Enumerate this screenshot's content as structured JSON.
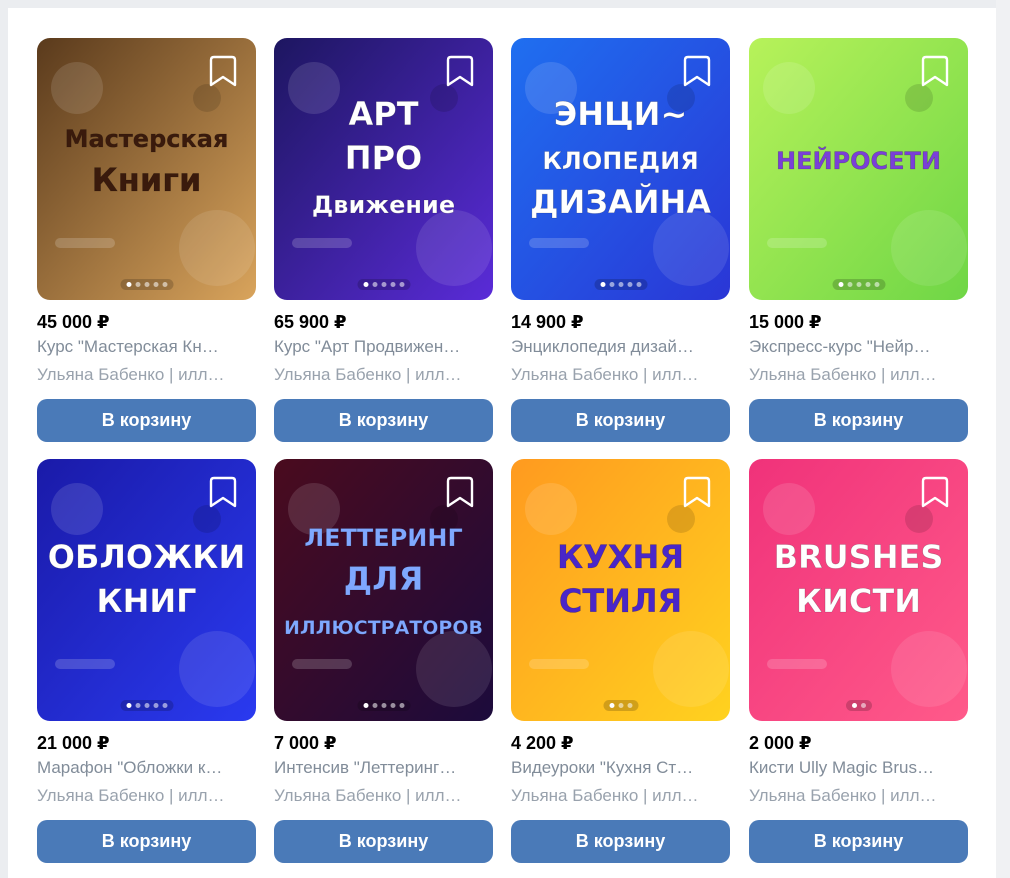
{
  "products": [
    {
      "price": "45 000 ₽",
      "title": "Курс \"Мастерская Кн…",
      "seller": "Ульяна Бабенко | илл…",
      "cart_label": "В корзину",
      "art": {
        "lines": [
          "Мастерская",
          "Книги"
        ],
        "colors": [
          "#5a3a1c",
          "#d9a45c"
        ],
        "text_color": "#3a1a0c"
      },
      "dots": 5,
      "active_dot": 0
    },
    {
      "price": "65 900 ₽",
      "title": "Курс \"Арт Продвижен…",
      "seller": "Ульяна Бабенко | илл…",
      "cart_label": "В корзину",
      "art": {
        "lines": [
          "АРТ",
          "ПРО",
          "Движение"
        ],
        "colors": [
          "#1d1660",
          "#5a2bd8"
        ],
        "text_color": "#ffffff"
      },
      "dots": 5,
      "active_dot": 0
    },
    {
      "price": "14 900 ₽",
      "title": "Энциклопедия дизай…",
      "seller": "Ульяна Бабенко | илл…",
      "cart_label": "В корзину",
      "art": {
        "lines": [
          "ЭНЦИ~",
          "КЛОПЕДИЯ",
          "ДИЗАЙНА"
        ],
        "colors": [
          "#1f6ff0",
          "#2a36d6"
        ],
        "text_color": "#ffffff"
      },
      "dots": 5,
      "active_dot": 0
    },
    {
      "price": "15 000 ₽",
      "title": "Экспресс-курс \"Нейр…",
      "seller": "Ульяна Бабенко | илл…",
      "cart_label": "В корзину",
      "art": {
        "lines": [
          "НЕЙРОСЕТИ"
        ],
        "colors": [
          "#b7f25a",
          "#6fd646"
        ],
        "text_color": "#7a3fd8"
      },
      "dots": 5,
      "active_dot": 0
    },
    {
      "price": "21 000 ₽",
      "title": "Марафон \"Обложки к…",
      "seller": "Ульяна Бабенко | илл…",
      "cart_label": "В корзину",
      "art": {
        "lines": [
          "ОБЛОЖКИ",
          "КНИГ"
        ],
        "colors": [
          "#1a1aa8",
          "#2a3af0"
        ],
        "text_color": "#ffffff"
      },
      "dots": 5,
      "active_dot": 0
    },
    {
      "price": "7 000 ₽",
      "title": "Интенсив \"Леттеринг…",
      "seller": "Ульяна Бабенко | илл…",
      "cart_label": "В корзину",
      "art": {
        "lines": [
          "ЛЕТТЕРИНГ",
          "ДЛЯ",
          "ИЛЛЮСТРАТОРОВ"
        ],
        "colors": [
          "#4a0b1e",
          "#1c0b3c"
        ],
        "text_color": "#7fa8ff"
      },
      "dots": 5,
      "active_dot": 0
    },
    {
      "price": "4 200 ₽",
      "title": "Видеуроки \"Кухня Ст…",
      "seller": "Ульяна Бабенко | илл…",
      "cart_label": "В корзину",
      "art": {
        "lines": [
          "КУХНЯ",
          "СТИЛЯ"
        ],
        "colors": [
          "#ff9a1f",
          "#ffd21f"
        ],
        "text_color": "#4a26c8"
      },
      "dots": 3,
      "active_dot": 0
    },
    {
      "price": "2 000 ₽",
      "title": "Кисти Ully Magic Brus…",
      "seller": "Ульяна Бабенко | илл…",
      "cart_label": "В корзину",
      "art": {
        "lines": [
          "BRUSHES",
          "КИСТИ"
        ],
        "colors": [
          "#f0327a",
          "#ff5a8a"
        ],
        "text_color": "#ffffff"
      },
      "dots": 2,
      "active_dot": 0
    }
  ]
}
